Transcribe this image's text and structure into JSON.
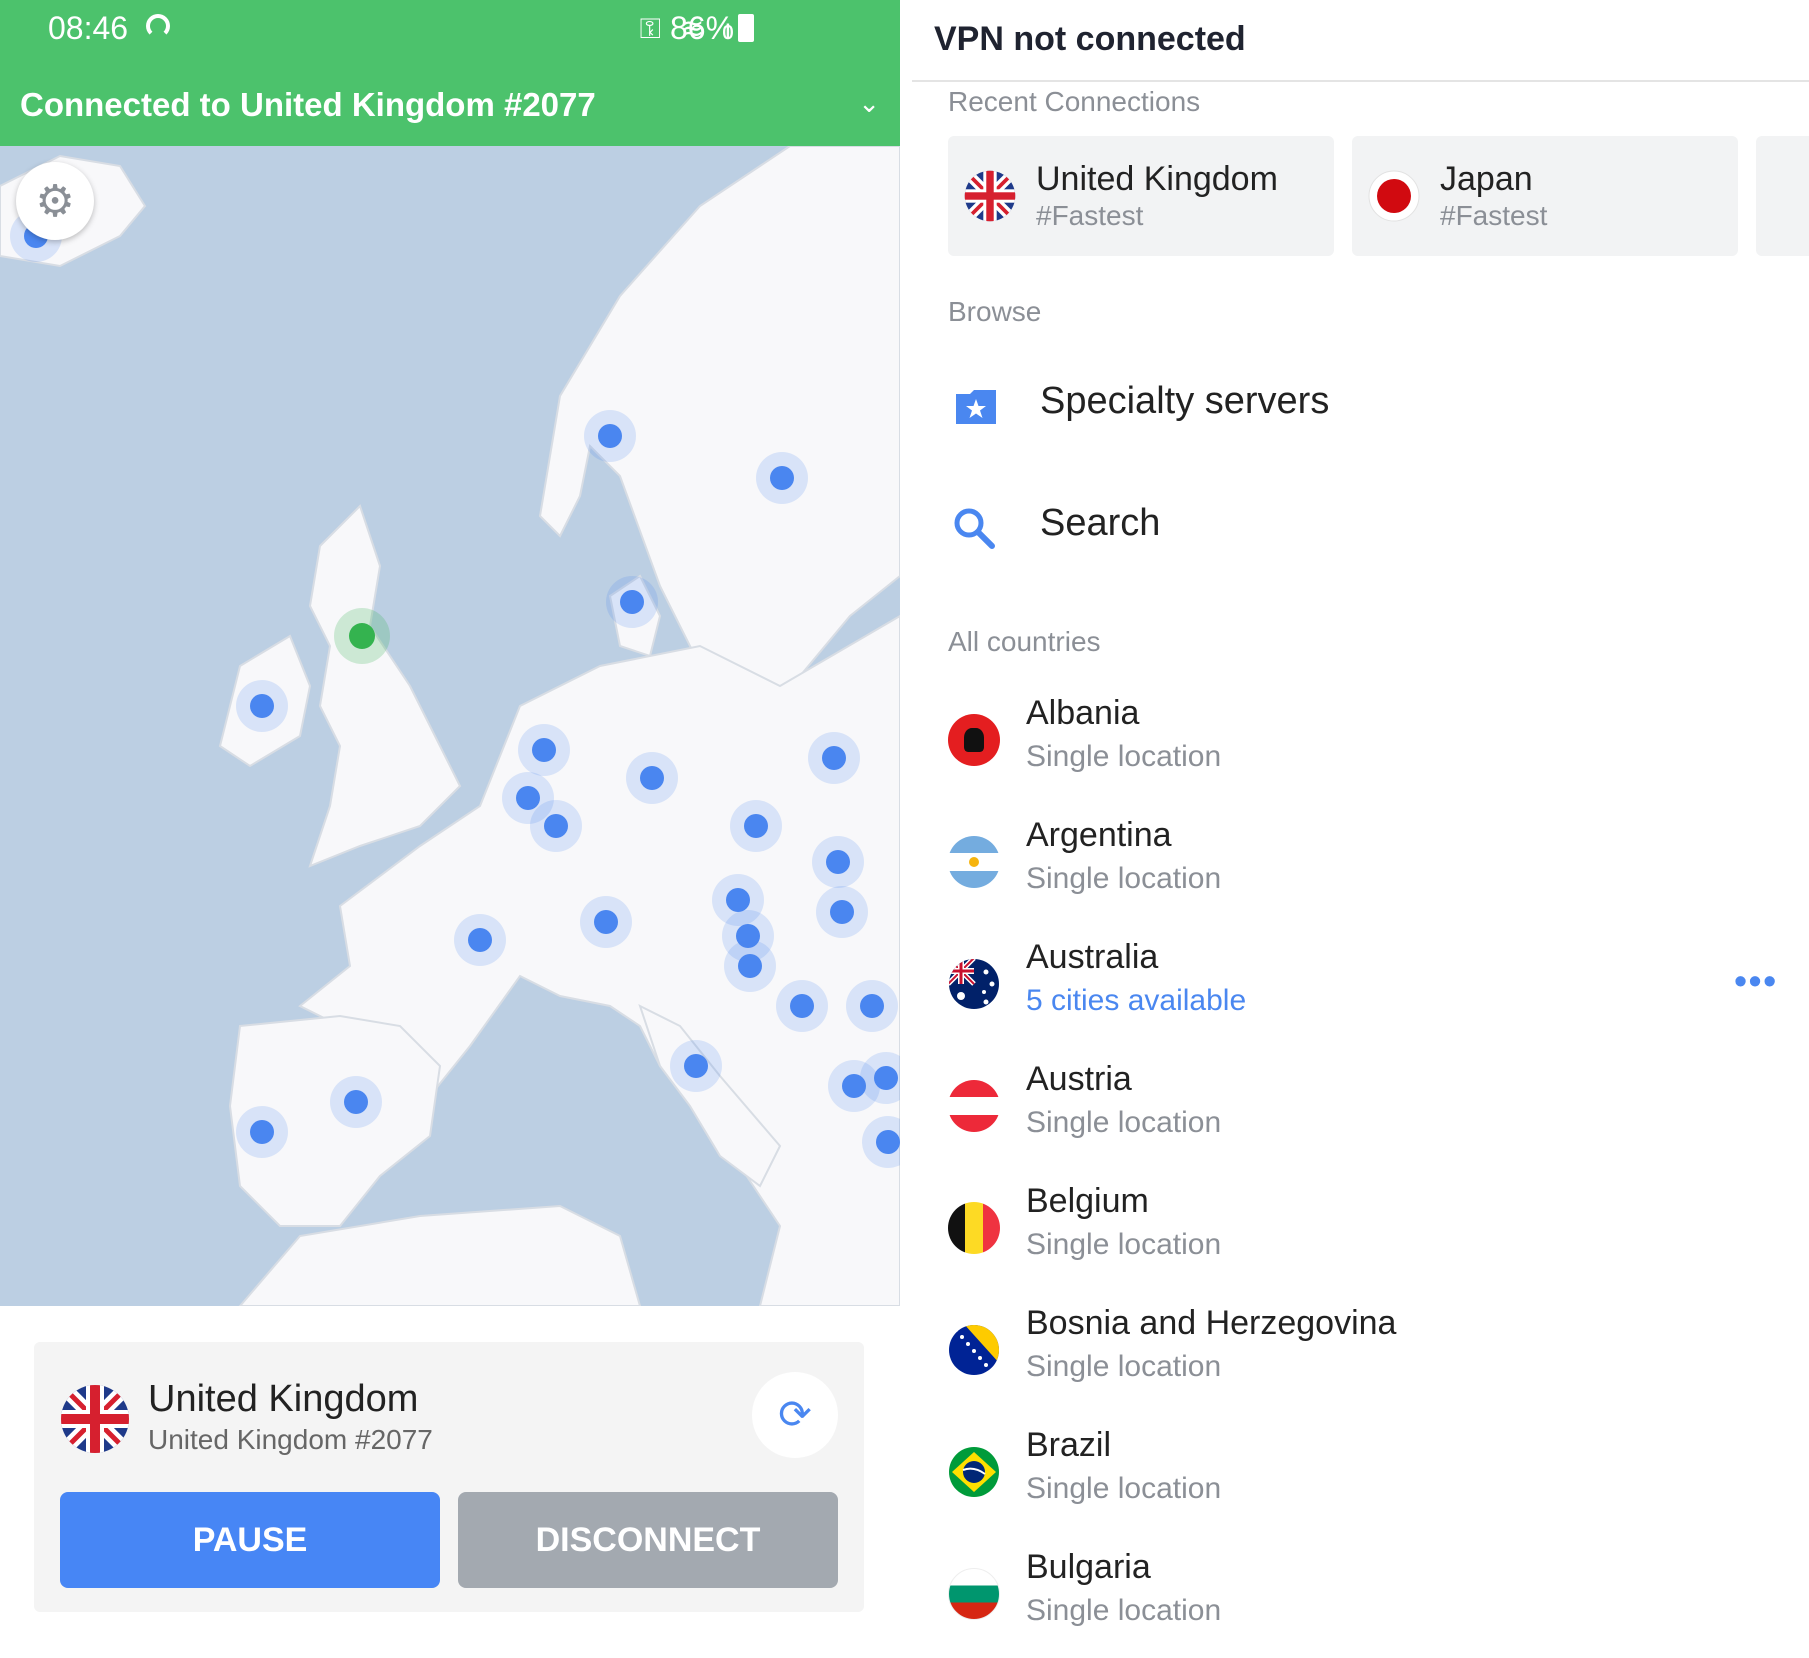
{
  "status_bar": {
    "time": "08:46",
    "battery": "86%"
  },
  "connection_banner": {
    "text": "Connected to United Kingdom #2077"
  },
  "map": {
    "connected_pin_color": "#34b34f",
    "pin_color": "#4a86f0"
  },
  "current_connection": {
    "country": "United Kingdom",
    "server": "United Kingdom #2077",
    "pause_label": "PAUSE",
    "disconnect_label": "DISCONNECT"
  },
  "right": {
    "vpn_status": "VPN not connected",
    "recent_title": "Recent Connections",
    "recent": [
      {
        "name": "United Kingdom",
        "sub": "#Fastest"
      },
      {
        "name": "Japan",
        "sub": "#Fastest"
      }
    ],
    "browse_title": "Browse",
    "browse": {
      "specialty": "Specialty servers",
      "search": "Search"
    },
    "all_title": "All countries",
    "countries": [
      {
        "name": "Albania",
        "sub": "Single location"
      },
      {
        "name": "Argentina",
        "sub": "Single location"
      },
      {
        "name": "Australia",
        "sub": "5 cities available"
      },
      {
        "name": "Austria",
        "sub": "Single location"
      },
      {
        "name": "Belgium",
        "sub": "Single location"
      },
      {
        "name": "Bosnia and Herzegovina",
        "sub": "Single location"
      },
      {
        "name": "Brazil",
        "sub": "Single location"
      },
      {
        "name": "Bulgaria",
        "sub": "Single location"
      }
    ]
  },
  "colors": {
    "green": "#4cc26c",
    "blue": "#4786f5",
    "grey_button": "#a3a9b0"
  }
}
